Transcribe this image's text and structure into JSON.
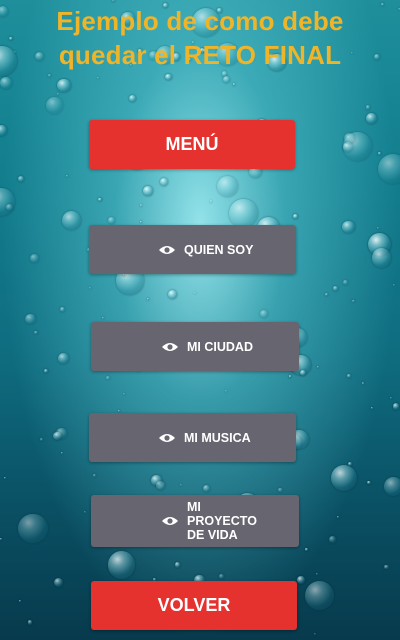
{
  "title": {
    "line1": "Ejemplo de como debe",
    "line2": "quedar el RETO FINAL"
  },
  "menu": {
    "label": "MENÚ",
    "items": [
      {
        "label": "QUIEN SOY",
        "icon": "eye-icon"
      },
      {
        "label": "MI CIUDAD",
        "icon": "eye-icon"
      },
      {
        "label": "MI MUSICA",
        "icon": "eye-icon"
      },
      {
        "label": "MI PROYECTO DE VIDA",
        "icon": "eye-icon"
      }
    ]
  },
  "back": {
    "label": "VOLVER"
  },
  "colors": {
    "title": "#f0b429",
    "primary_button": "#e5322f",
    "menu_item": "#676570",
    "background": "#137f8f"
  }
}
